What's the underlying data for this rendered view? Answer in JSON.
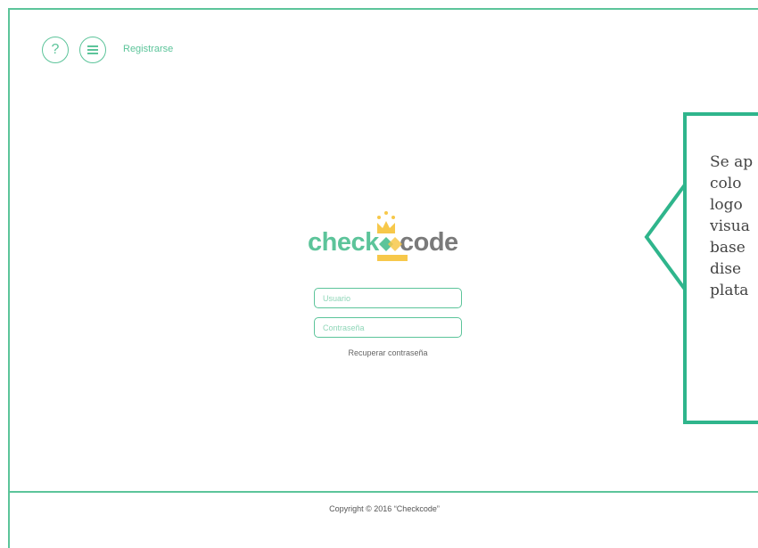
{
  "header": {
    "help_icon": "question-icon",
    "help_glyph": "?",
    "menu_icon": "hamburger-icon",
    "register_label": "Registrarse"
  },
  "logo": {
    "part1": "check",
    "part2": "code",
    "colors": {
      "green": "#5cc49a",
      "gray": "#7a7a7a",
      "gold": "#f7c84a"
    }
  },
  "login": {
    "user_placeholder": "Usuario",
    "password_placeholder": "Contraseña",
    "recover_label": "Recuperar contraseña"
  },
  "callout": {
    "lines": [
      "Se ap",
      "colo",
      "logo",
      "visua",
      "base",
      "dise",
      "plata"
    ]
  },
  "footer": {
    "copyright": "Copyright © 2016 “Checkcode”"
  },
  "colors": {
    "accent": "#5cc49a",
    "callout_border": "#2fb58c"
  }
}
